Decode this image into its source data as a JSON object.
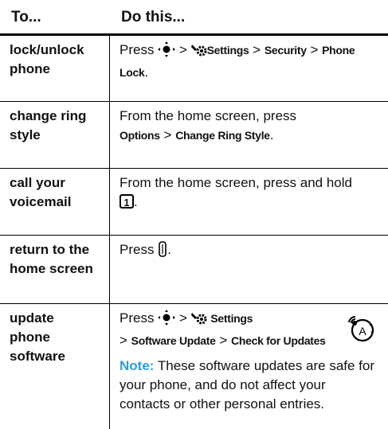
{
  "header": {
    "col1": "To...",
    "col2": "Do this..."
  },
  "rows": [
    {
      "label": "lock/unlock phone",
      "press": "Press",
      "gt1": ">",
      "settings": "Settings",
      "gt2": ">",
      "security": "Security",
      "gt3": ">",
      "phone_lock_a": "Phone",
      "phone_lock_b": "Lock",
      "end": "."
    },
    {
      "label": "change ring style",
      "line1": "From the home screen, press",
      "options": "Options",
      "gt": ">",
      "change_ring": "Change Ring Style",
      "end": "."
    },
    {
      "label": "call your voicemail",
      "line1": "From the home screen, press and hold",
      "key": "1",
      "end": "."
    },
    {
      "label": "return to the home screen",
      "press": "Press",
      "end": "."
    },
    {
      "label": "update phone software",
      "press": "Press",
      "gt1": ">",
      "settings": "Settings",
      "gt2": ">",
      "software_update": "Software Update",
      "gt3": ">",
      "check_updates": "Check for Updates",
      "note_label": "Note:",
      "note_text": "These software updates are safe for your phone, and do not affect your contacts or other personal entries."
    }
  ]
}
